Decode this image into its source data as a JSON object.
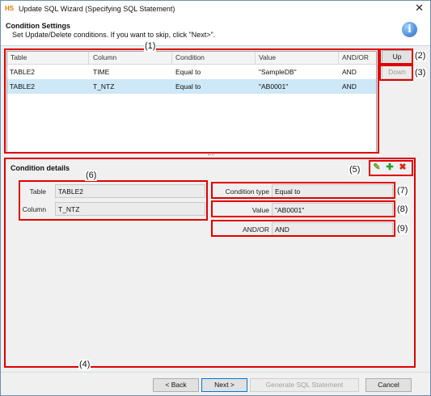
{
  "window": {
    "app_icon": "HS",
    "title": "Update SQL Wizard (Specifying SQL Statement)",
    "close_glyph": "✕"
  },
  "header": {
    "title": "Condition Settings",
    "subtitle": "Set Update/Delete conditions. If you want to skip, click \"Next>\".",
    "info_glyph": "i"
  },
  "grid": {
    "columns": [
      "Table",
      "Column",
      "Condition",
      "Value",
      "AND/OR"
    ],
    "rows": [
      [
        "TABLE2",
        "TIME",
        "Equal to",
        "\"SampleDB\"",
        "AND"
      ],
      [
        "TABLE2",
        "T_NTZ",
        "Equal to",
        "\"AB0001\"",
        "AND"
      ]
    ],
    "selected_row": 1
  },
  "buttons": {
    "up": "Up",
    "down": "Down"
  },
  "details": {
    "title": "Condition details",
    "table_label": "Table",
    "table_value": "TABLE2",
    "column_label": "Column",
    "column_value": "T_NTZ",
    "condition_type_label": "Condition type",
    "condition_type_value": "Equal to",
    "value_label": "Value",
    "value_value": "\"AB0001\"",
    "andor_label": "AND/OR",
    "andor_value": "AND"
  },
  "icons": {
    "edit": "pencil-icon",
    "add": "plus-icon",
    "delete": "cross-icon"
  },
  "annotations": [
    "(1)",
    "(2)",
    "(3)",
    "(4)",
    "(5)",
    "(6)",
    "(7)",
    "(8)",
    "(9)"
  ],
  "footer": {
    "back": "< Back",
    "next": "Next >",
    "generate": "Generate SQL Statement",
    "cancel": "Cancel"
  },
  "colors": {
    "annotation": "#e00000",
    "selection": "#cde8f6",
    "primary_border": "#0078d7"
  }
}
